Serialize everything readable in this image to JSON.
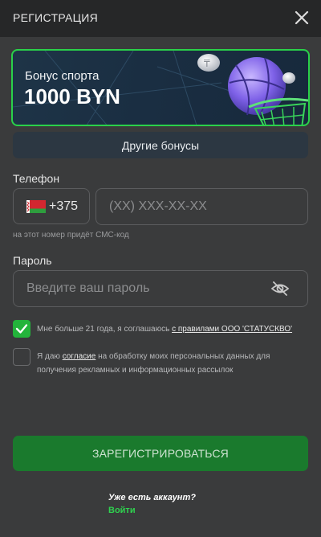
{
  "header": {
    "title": "РЕГИСТРАЦИЯ"
  },
  "banner": {
    "subtitle": "Бонус спорта",
    "amount": "1000 BYN",
    "accent_color": "#2ad14a"
  },
  "other_bonuses_label": "Другие бонусы",
  "phone": {
    "label": "Телефон",
    "country_code": "+375",
    "flag": "belarus-flag-icon",
    "placeholder": "(XX) XXX-XX-XX",
    "hint": "на этот номер придёт СМС-код"
  },
  "password": {
    "label": "Пароль",
    "placeholder": "Введите ваш пароль"
  },
  "agreements": {
    "age_text": "Мне больше 21 года, я соглашаюсь ",
    "age_link": "с правилами ООО 'СТАТУСКВО'",
    "age_checked": true,
    "consent_prefix": "Я даю ",
    "consent_link": "согласие",
    "consent_line1_rest": " на обработку моих персональных данных для",
    "consent_line2": "получения рекламных и информационных рассылок",
    "consent_checked": false
  },
  "register_button": "ЗАРЕГИСТРИРОВАТЬСЯ",
  "footer": {
    "have_account": "Уже есть аккаунт?",
    "login_link": "Войти"
  },
  "colors": {
    "background": "#3a3b3c",
    "header": "#262728",
    "primary_green": "#1a7a2d",
    "link_green": "#2fd24f"
  }
}
